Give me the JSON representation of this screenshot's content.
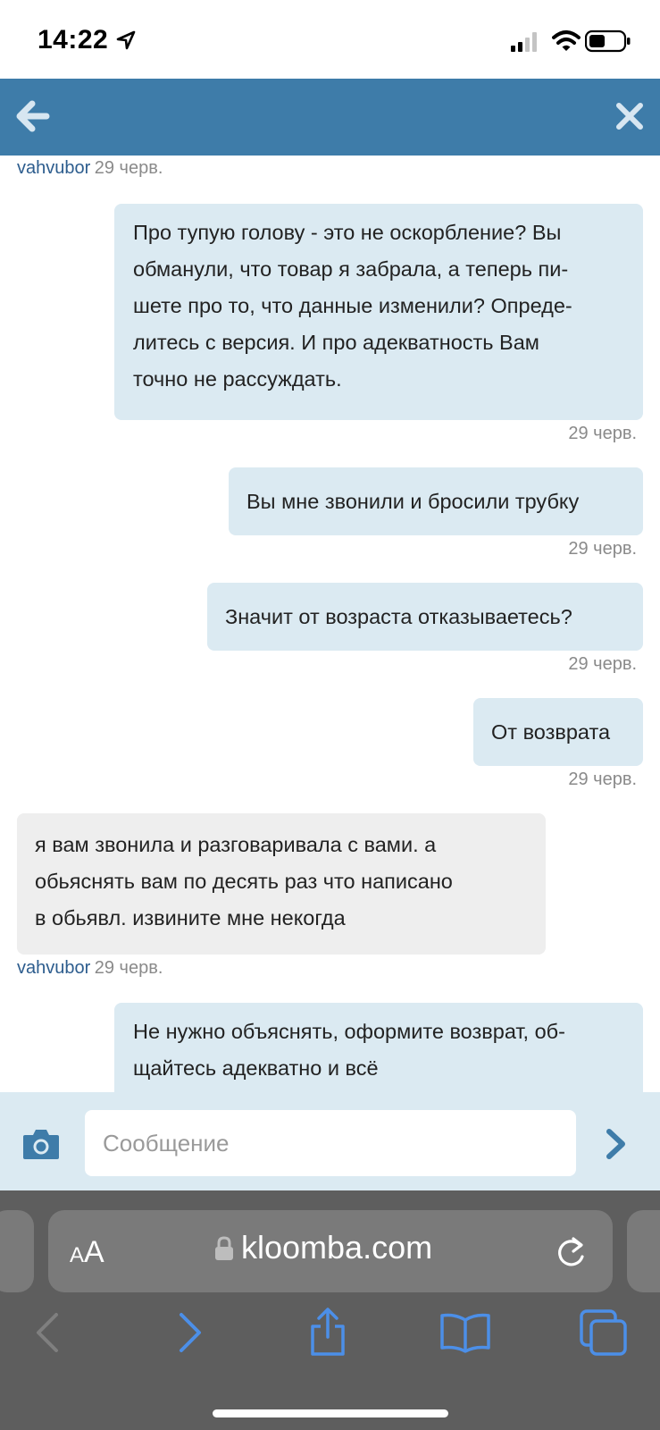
{
  "status_bar": {
    "time": "14:22",
    "icons": [
      "location-arrow-icon",
      "cellular-signal-icon",
      "wifi-icon",
      "battery-icon"
    ]
  },
  "header": {
    "icons": [
      "back-arrow-icon",
      "close-icon"
    ],
    "color": "#3e7ca9"
  },
  "chat": {
    "top_meta": {
      "author": "vahvubor",
      "date": "29 черв."
    },
    "messages": [
      {
        "direction": "outgoing",
        "lines": [
          "Про тупую голову - это не оскорбление? Вы",
          "обманули, что товар я забрала, а теперь пи-",
          "шете про то, что данные изменили? Опреде-",
          "литесь с версия. И про адекватность Вам",
          "точно не рассуждать."
        ],
        "date": "29 черв."
      },
      {
        "direction": "outgoing",
        "lines": [
          "Вы мне звонили и бросили трубку"
        ],
        "date": "29 черв."
      },
      {
        "direction": "outgoing",
        "lines": [
          "Значит от возраста отказываетесь?"
        ],
        "date": "29 черв."
      },
      {
        "direction": "outgoing",
        "lines": [
          "От возврата"
        ],
        "date": "29 черв."
      },
      {
        "direction": "incoming",
        "lines": [
          "я вам звонила и разговаривала с вами. а",
          "обьяснять вам по десять раз что написано",
          "в обьявл. извините мне некогда"
        ],
        "author": "vahvubor",
        "date": "29 черв."
      },
      {
        "direction": "outgoing",
        "lines": [
          "Не нужно объяснять, оформите возврат, об-",
          "щайтесь адекватно и всё"
        ]
      }
    ],
    "bubble_colors": {
      "outgoing": "#dbeaf2",
      "incoming": "#eeeeee"
    }
  },
  "composer": {
    "placeholder": "Сообщение",
    "value": "",
    "icons": [
      "camera-icon",
      "send-chevron-icon"
    ]
  },
  "browser": {
    "text_size_label": {
      "small": "A",
      "large": "A"
    },
    "url": "kloomba.com",
    "icons": [
      "lock-icon",
      "reload-icon",
      "back-icon",
      "forward-icon",
      "share-icon",
      "bookmarks-icon",
      "tabs-icon"
    ]
  }
}
